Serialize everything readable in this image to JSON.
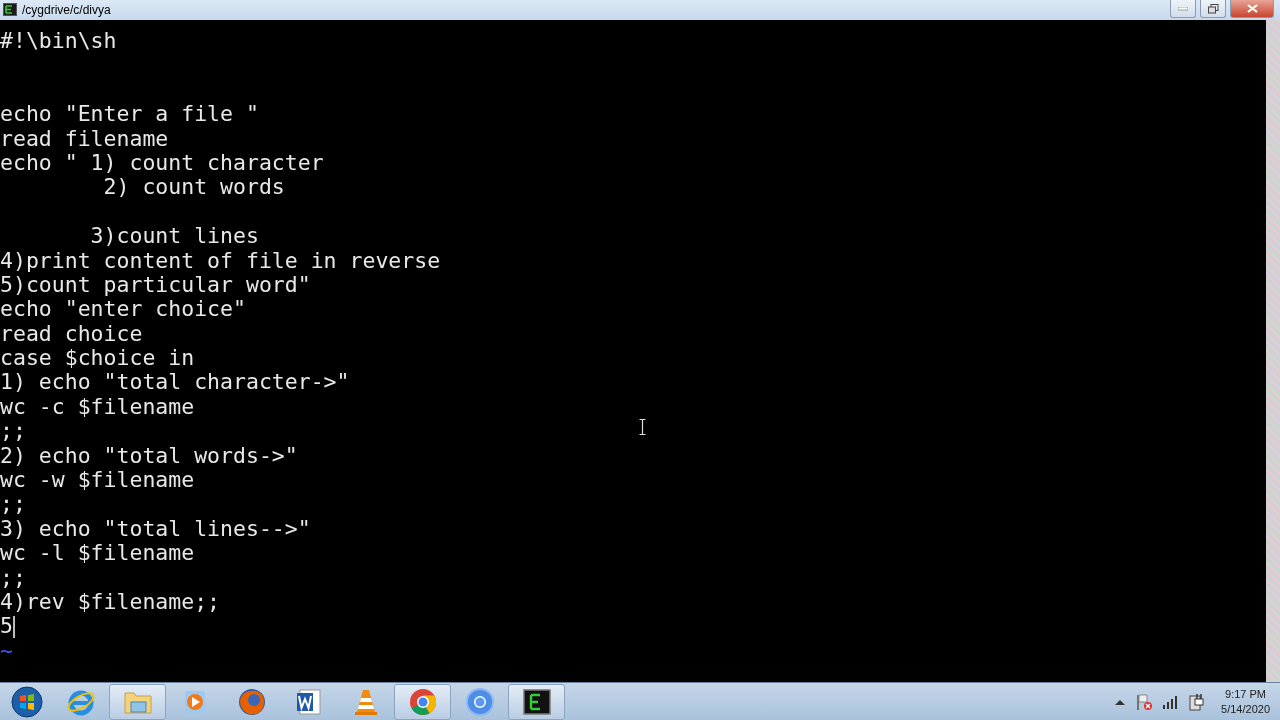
{
  "window": {
    "title": "/cygdrive/c/divya"
  },
  "terminal": {
    "lines": [
      {
        "kind": "text",
        "text": "#!\\bin\\sh"
      },
      {
        "kind": "blank"
      },
      {
        "kind": "blank"
      },
      {
        "kind": "text",
        "text": "echo \"Enter a file \""
      },
      {
        "kind": "text",
        "text": "read filename"
      },
      {
        "kind": "text",
        "text": "echo \" 1) count character"
      },
      {
        "kind": "text",
        "text": "        2) count words"
      },
      {
        "kind": "blank"
      },
      {
        "kind": "text",
        "text": "       3)count lines"
      },
      {
        "kind": "text",
        "text": "4)print content of file in reverse"
      },
      {
        "kind": "text",
        "text": "5)count particular word\""
      },
      {
        "kind": "text",
        "text": "echo \"enter choice\""
      },
      {
        "kind": "text",
        "text": "read choice"
      },
      {
        "kind": "text",
        "text": "case $choice in"
      },
      {
        "kind": "text",
        "text": "1) echo \"total character->\""
      },
      {
        "kind": "text",
        "text": "wc -c $filename"
      },
      {
        "kind": "text",
        "text": ";;"
      },
      {
        "kind": "text",
        "text": "2) echo \"total words->\""
      },
      {
        "kind": "text",
        "text": "wc -w $filename"
      },
      {
        "kind": "text",
        "text": ";;"
      },
      {
        "kind": "text",
        "text": "3) echo \"total lines-->\""
      },
      {
        "kind": "text",
        "text": "wc -l $filename"
      },
      {
        "kind": "text",
        "text": ";;"
      },
      {
        "kind": "text",
        "text": "4)rev $filename;;"
      },
      {
        "kind": "cursor",
        "text": "5"
      },
      {
        "kind": "tilde",
        "text": "~"
      }
    ]
  },
  "taskbar": {
    "apps": [
      {
        "kind": "start",
        "running": false
      },
      {
        "kind": "ie",
        "running": false
      },
      {
        "kind": "explorer",
        "running": true
      },
      {
        "kind": "media",
        "running": false
      },
      {
        "kind": "firefox",
        "running": false
      },
      {
        "kind": "word",
        "running": false
      },
      {
        "kind": "vlc",
        "running": false
      },
      {
        "kind": "chrome",
        "running": true
      },
      {
        "kind": "chromium",
        "running": false
      },
      {
        "kind": "terminal",
        "running": true
      }
    ],
    "clock": {
      "time": "9:17 PM",
      "date": "5/14/2020"
    }
  }
}
